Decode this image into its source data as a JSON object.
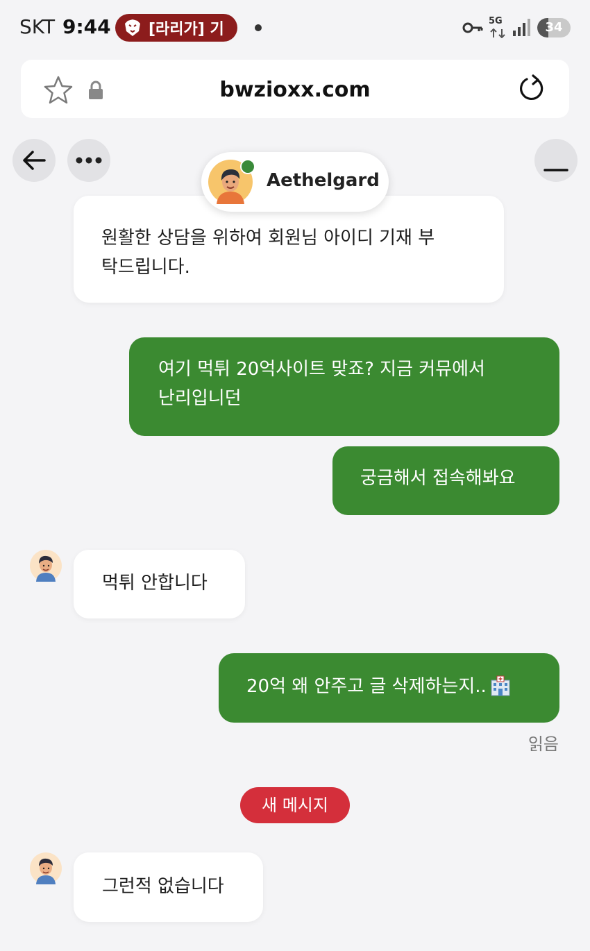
{
  "status_bar": {
    "carrier": "SKT",
    "time": "9:44",
    "notification": "[라리가] 기",
    "network": "5G",
    "battery": "34",
    "battery_level": 0.34
  },
  "url_bar": {
    "url": "bwzioxx.com"
  },
  "agent": {
    "name": "Aethelgard",
    "status_color": "#3a8a3a"
  },
  "colors": {
    "outgoing_bubble": "#3b8a31",
    "new_message_badge": "#d42f3b"
  },
  "messages": [
    {
      "direction": "in",
      "text": "원활한 상담을 위하여 회원님 아이디 기재 부\n탁드립니다."
    },
    {
      "direction": "out",
      "text": "여기 먹튀 20억사이트 맞죠? 지금 커뮤에서\n난리입니던"
    },
    {
      "direction": "out",
      "text": "궁금해서 접속해봐요"
    },
    {
      "direction": "in",
      "text": "먹튀 안합니다"
    },
    {
      "direction": "out",
      "text": "20억 왜 안주고 글 삭제하는지.."
    },
    {
      "direction": "in",
      "text": "그런적 없습니다"
    }
  ],
  "read_receipt": "읽음",
  "new_message_label": "새 메시지"
}
